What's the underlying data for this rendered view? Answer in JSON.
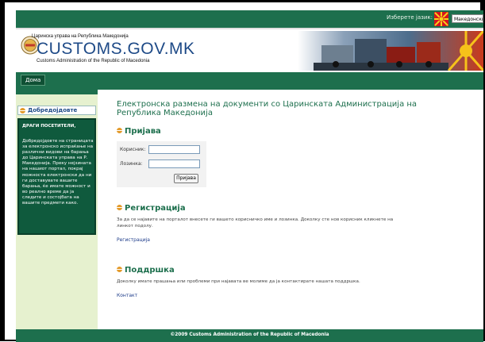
{
  "topbar": {
    "language_label": "Изберете јазик:",
    "language_selected": "Македонски"
  },
  "header": {
    "org_name_mk": "Царинска управа на Република Македонија",
    "site_name": "CUSTOMS.GOV.MK",
    "org_name_en": "Customs Administration of the Republic of Macedonia"
  },
  "nav": {
    "home": "Дома"
  },
  "sidebar": {
    "title": "Добредојдовте",
    "heading": "ДРАГИ ПОСЕТИТЕЛИ,",
    "text": "Добредојдовте на страницата за електронско испраќање на различни видови на барања до Царинската управа на Р. Македонија. Преку нејзината на нашиот портал, покрај можноста електронски да ни ги доставувате вашите барања, ќе имате можност и во реално време да ја следите и состојбата на вашите предмети како."
  },
  "main": {
    "title": "Електронска размена на документи со Царинската Администрација на Република Македонија",
    "login": {
      "heading": "Пријава",
      "username_label": "Корисник:",
      "password_label": "Лозинка:",
      "username_value": "",
      "password_value": "",
      "submit": "Пријава"
    },
    "register": {
      "heading": "Регистрација",
      "text": "За да се најавите на порталот внесете ги вашето корисничко име и лозинка. Доколку сте нов корисник кликнете на линкот подолу.",
      "link": "Регистрација"
    },
    "support": {
      "heading": "Поддршка",
      "text": "Доколку имате прашања или проблеми при најавата ве молиме да ја контактирате нашата поддршка.",
      "link": "Контакт"
    }
  },
  "footer": {
    "text": "©2009 Customs Administration of the Republic of Macedonia"
  },
  "colors": {
    "brand_green": "#1d6f4d",
    "sidebar_bg": "#e6f1cf",
    "title_blue": "#1e4a87",
    "accent_orange": "#e39a2a"
  },
  "icons": [
    "macedonian-sun-icon",
    "customs-seal-icon",
    "section-bullet-icon"
  ]
}
